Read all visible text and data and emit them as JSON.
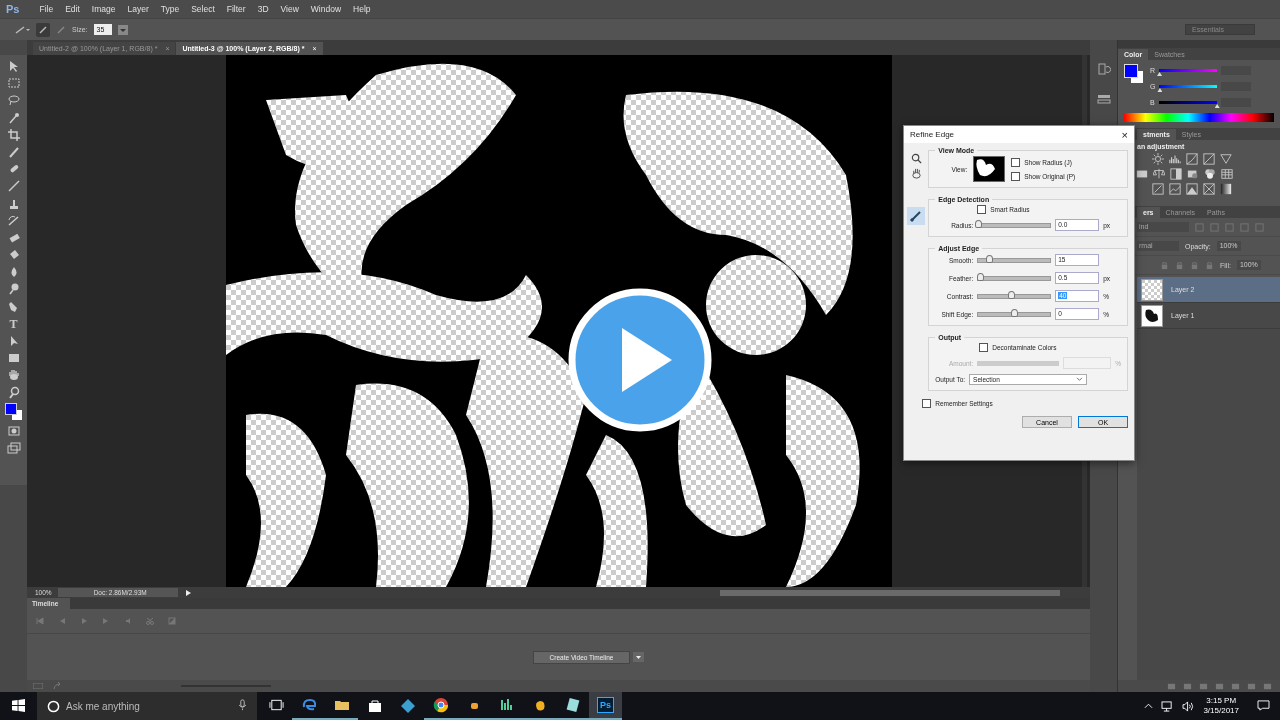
{
  "app_logo": "Ps",
  "menu": [
    "File",
    "Edit",
    "Image",
    "Layer",
    "Type",
    "Select",
    "Filter",
    "3D",
    "View",
    "Window",
    "Help"
  ],
  "options_bar": {
    "size_label": "Size:",
    "size_value": "35",
    "workspace": "Essentials"
  },
  "documents": [
    {
      "title": "Untitled-2 @ 100% (Layer 1, RGB/8) *",
      "close": "×",
      "selected": false
    },
    {
      "title": "Untitled-3 @ 100% (Layer 2, RGB/8) *",
      "close": "×",
      "selected": true
    }
  ],
  "toolbar": {
    "type_tool": "T"
  },
  "status_bar": {
    "zoom": "100%",
    "doc": "Doc: 2.86M/2.93M"
  },
  "timeline": {
    "tab": "Timeline",
    "create_button": "Create Video Timeline"
  },
  "dialog": {
    "title": "Refine Edge",
    "close": "×",
    "view_mode": {
      "title": "View Mode",
      "view_label": "View:",
      "options": [
        {
          "label": "Show Radius (J)",
          "checked": false
        },
        {
          "label": "Show Original (P)",
          "checked": false
        }
      ]
    },
    "edge_detection": {
      "title": "Edge Detection",
      "smart_radius": {
        "label": "Smart Radius",
        "checked": false
      },
      "radius": {
        "label": "Radius:",
        "value": "0.0",
        "unit": "px",
        "level": 0
      }
    },
    "adjust_edge": {
      "title": "Adjust Edge",
      "sliders": [
        {
          "label": "Smooth:",
          "value": "15",
          "level": 0.15,
          "highlighted": false
        },
        {
          "label": "Feather:",
          "value": "0.5",
          "unit": "px",
          "level": 0.02,
          "highlighted": false
        },
        {
          "label": "Contrast:",
          "value": "40",
          "unit": "%",
          "level": 0.45,
          "highlighted": true
        },
        {
          "label": "Shift Edge:",
          "value": "0",
          "unit": "%",
          "level": 0.5,
          "highlighted": false
        }
      ]
    },
    "output": {
      "title": "Output",
      "decontaminate": {
        "label": "Decontaminate Colors",
        "checked": false
      },
      "amount": {
        "label": "Amount:",
        "unit": "%",
        "disabled": true
      },
      "output_to": {
        "label": "Output To:",
        "value": "Selection"
      }
    },
    "remember": {
      "label": "Remember Settings",
      "checked": false
    },
    "buttons": [
      {
        "label": "Cancel",
        "default": false
      },
      {
        "label": "OK",
        "default": true
      }
    ]
  },
  "panels": {
    "color": {
      "tabs": [
        {
          "label": "Color",
          "selected": true
        },
        {
          "label": "Swatches",
          "selected": false
        }
      ],
      "channels": [
        {
          "label": "R",
          "level": 0
        },
        {
          "label": "G",
          "level": 0
        },
        {
          "label": "B",
          "level": 1
        }
      ]
    },
    "adjustments": {
      "tabs": [
        {
          "label": "stments",
          "selected": true
        },
        {
          "label": "Styles",
          "selected": false
        }
      ],
      "heading": "an adjustment"
    },
    "layers": {
      "tabs": [
        {
          "label": "ers",
          "selected": true
        },
        {
          "label": "Channels",
          "selected": false
        },
        {
          "label": "Paths",
          "selected": false
        }
      ],
      "filter": "ind",
      "blend_mode": "rmal",
      "opacity_label": "Opacity:",
      "opacity": "100%",
      "fill_label": "Fill:",
      "fill": "100%",
      "layers": [
        {
          "name": "Layer 2",
          "kind": "transparent",
          "selected": true
        },
        {
          "name": "Layer 1",
          "kind": "artwork",
          "selected": false
        }
      ]
    }
  },
  "taskbar": {
    "search_placeholder": "Ask me anything",
    "apps": [
      {
        "kind": "edge",
        "running": true,
        "selected": false
      },
      {
        "kind": "folder",
        "running": true,
        "selected": false
      },
      {
        "kind": "store",
        "running": false,
        "selected": false
      },
      {
        "kind": "diamond",
        "running": false,
        "selected": false
      },
      {
        "kind": "chrome",
        "running": true,
        "selected": false
      },
      {
        "kind": "small",
        "running": true,
        "selected": false
      },
      {
        "kind": "bars",
        "running": true,
        "selected": false
      },
      {
        "kind": "fruit",
        "running": true,
        "selected": false
      },
      {
        "kind": "notepad",
        "running": true,
        "selected": false
      },
      {
        "kind": "ps",
        "label": "Ps",
        "running": true,
        "selected": true
      }
    ],
    "time": "3:15 PM",
    "date": "3/15/2017"
  }
}
